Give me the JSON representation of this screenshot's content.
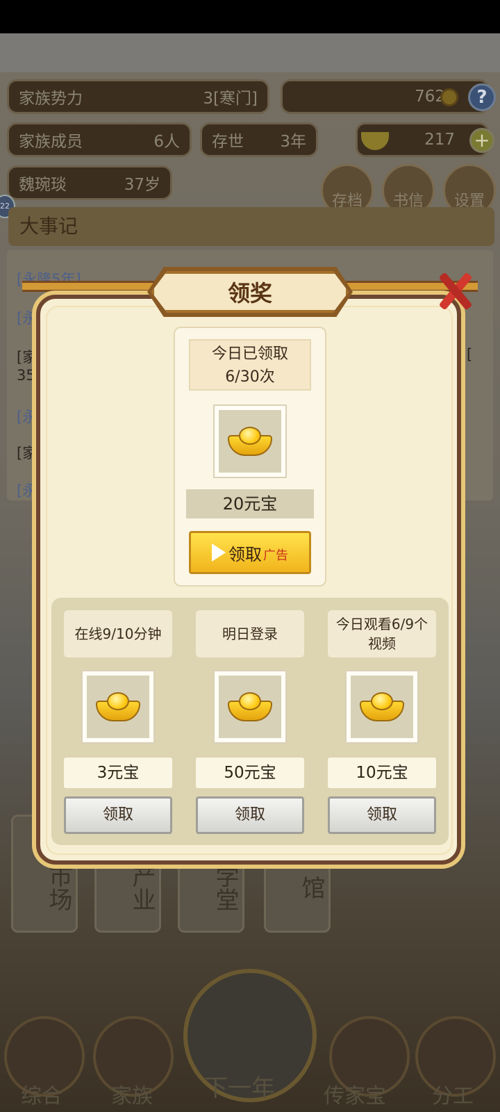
{
  "header": {
    "family_power_label": "家族势力",
    "family_power_value": "3[寒门]",
    "coins": "762",
    "members_label": "家族成员",
    "members_value": "6人",
    "existence_label": "存世",
    "existence_value": "3年",
    "ingots": "217",
    "character_name": "魏琬琰",
    "character_age": "37岁",
    "save_label": "存档",
    "letter_label": "书信",
    "settings_label": "设置",
    "badge": "22"
  },
  "event_log": {
    "title": "大事记",
    "lines": [
      "[永隆5年]",
      "[永",
      "[家",
      "35",
      "[永",
      "[家",
      "[永",
      "["
    ]
  },
  "buildings": [
    "市场",
    "产业",
    "学堂",
    "馆"
  ],
  "bottom_nav": [
    "综合",
    "家族",
    "下一年",
    "传家宝",
    "分工"
  ],
  "dialog": {
    "title": "领奖",
    "ad_reward": {
      "count_line1": "今日已领取",
      "count_line2": "6/30次",
      "amount": "20元宝",
      "claim_label": "领取",
      "ad_tag": "广告"
    },
    "tasks": [
      {
        "label": "在线9/10分钟",
        "amount": "3元宝",
        "claim_label": "领取"
      },
      {
        "label": "明日登录",
        "amount": "50元宝",
        "claim_label": "领取"
      },
      {
        "label": "今日观看6/9个视频",
        "amount": "10元宝",
        "claim_label": "领取"
      }
    ]
  }
}
